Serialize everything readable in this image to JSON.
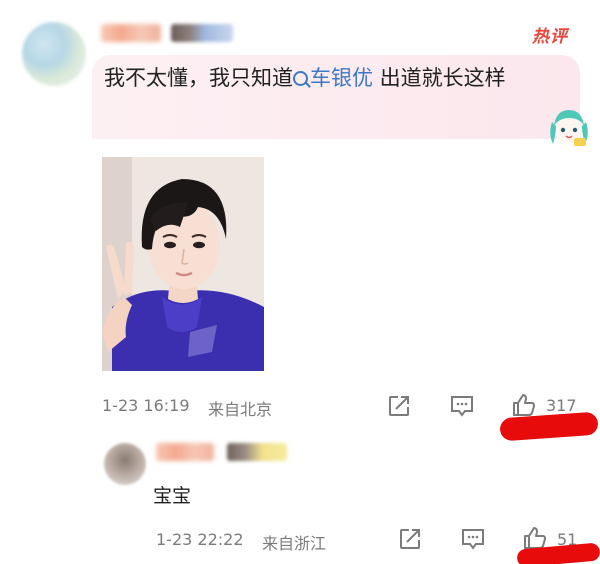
{
  "comment": {
    "text_before": "我不太懂，我只知道",
    "mention": "车银优",
    "text_after": " 出道就长这样",
    "hot_label": "热评",
    "time": "1-23 16:19",
    "location": "来自北京",
    "likes": "317"
  },
  "reply": {
    "text": "宝宝",
    "time": "1-23 22:22",
    "location": "来自浙江",
    "likes": "51"
  },
  "colors": {
    "hot": "#e8473c",
    "mention": "#3d78c8",
    "bubble": "#fbe7ed",
    "marker": "#e80b0b"
  }
}
